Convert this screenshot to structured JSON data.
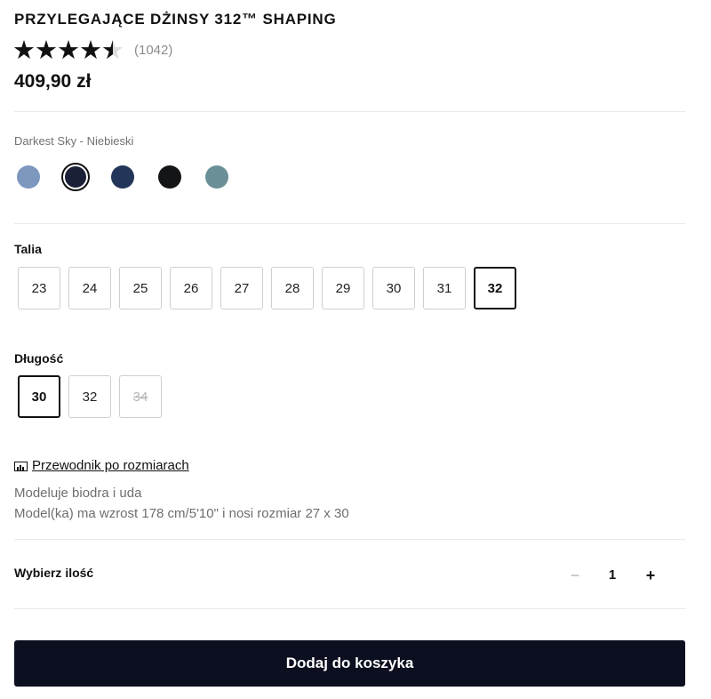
{
  "product": {
    "title": "PRZYLEGAJĄCE DŻINSY 312™ SHAPING",
    "rating_stars": 4.5,
    "review_count": "(1042)",
    "price": "409,90 zł"
  },
  "color": {
    "selected_name": "Darkest Sky - Niebieski",
    "swatches": [
      {
        "color": "#7d97bf",
        "selected": false
      },
      {
        "color": "#1a2038",
        "selected": true
      },
      {
        "color": "#233659",
        "selected": false
      },
      {
        "color": "#141516",
        "selected": false
      },
      {
        "color": "#6b8f96",
        "selected": false
      }
    ]
  },
  "waist": {
    "label": "Talia",
    "sizes": [
      "23",
      "24",
      "25",
      "26",
      "27",
      "28",
      "29",
      "30",
      "31",
      "32"
    ],
    "selected": "32"
  },
  "length": {
    "label": "Długość",
    "sizes": [
      "30",
      "32",
      "34"
    ],
    "selected": "30",
    "unavailable": [
      "34"
    ]
  },
  "size_guide": {
    "label": "Przewodnik po rozmiarach",
    "icon": "ruler-icon"
  },
  "description": {
    "fit": "Modeluje biodra i uda",
    "model": "Model(ka) ma wzrost 178 cm/5'10\" i nosi rozmiar 27 x 30"
  },
  "quantity": {
    "label": "Wybierz ilość",
    "value": "1",
    "minus": "−",
    "plus": "+"
  },
  "cart": {
    "add_label": "Dodaj do koszyka"
  },
  "colors": {
    "button_bg": "#0c0f1f",
    "divider": "#e9e9e9",
    "muted_text": "#6e6e6e"
  }
}
